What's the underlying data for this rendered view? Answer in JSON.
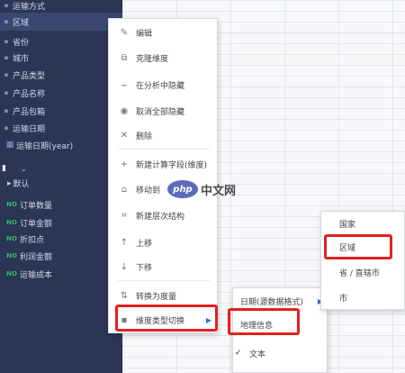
{
  "fields": {
    "dimensions": [
      {
        "label": "运输方式",
        "icon": "abc-icon"
      },
      {
        "label": "区域",
        "icon": "abc-icon"
      },
      {
        "label": "省份",
        "icon": "abc-icon"
      },
      {
        "label": "城市",
        "icon": "abc-icon"
      },
      {
        "label": "产品类型",
        "icon": "abc-icon"
      },
      {
        "label": "产品名称",
        "icon": "abc-icon"
      },
      {
        "label": "产品包箱",
        "icon": "abc-icon"
      },
      {
        "label": "运输日期",
        "icon": "abc-icon"
      },
      {
        "label": "运输日期(year)",
        "icon": "calendar-icon"
      }
    ],
    "group": {
      "label": "默认"
    },
    "measures": [
      {
        "tag": "NO",
        "label": "订单数量"
      },
      {
        "tag": "NO",
        "label": "订单金额"
      },
      {
        "tag": "NO",
        "label": "折扣点"
      },
      {
        "tag": "NO",
        "label": "利润金额"
      },
      {
        "tag": "NO",
        "label": "运输成本"
      }
    ]
  },
  "context_menu": {
    "items": [
      {
        "label": "编辑",
        "icon": "pencil-icon"
      },
      {
        "label": "克隆维度",
        "icon": "clone-icon"
      },
      {
        "label": "在分析中隐藏",
        "icon": "eye-hide-icon"
      },
      {
        "label": "取消全部隐藏",
        "icon": "eye-icon"
      },
      {
        "label": "删除",
        "icon": "close-icon"
      },
      {
        "label": "新建计算字段(维度)",
        "icon": "plus-icon"
      },
      {
        "label": "移动到",
        "icon": "move-icon"
      },
      {
        "label": "新建层次结构",
        "icon": "hierarchy-icon"
      },
      {
        "label": "上移",
        "icon": "arrow-up-icon"
      },
      {
        "label": "下移",
        "icon": "arrow-down-icon"
      },
      {
        "label": "转换为度量",
        "icon": "convert-icon"
      },
      {
        "label": "维度类型切换",
        "icon": "switch-icon"
      }
    ]
  },
  "submenu_type": {
    "items": [
      {
        "label": "日期(源数据格式)"
      },
      {
        "label": "地理信息"
      },
      {
        "label": "文本",
        "checked_mark": "✓"
      }
    ]
  },
  "submenu_geo": {
    "items": [
      {
        "label": "国家"
      },
      {
        "label": "区域"
      },
      {
        "label": "省 / 直辖市"
      },
      {
        "label": "市"
      }
    ]
  },
  "watermark": {
    "logo": "php",
    "text": "中文网"
  },
  "colors": {
    "highlight": "#e1221e",
    "panel": "#2b3554",
    "measure_tag": "#38b76d"
  }
}
